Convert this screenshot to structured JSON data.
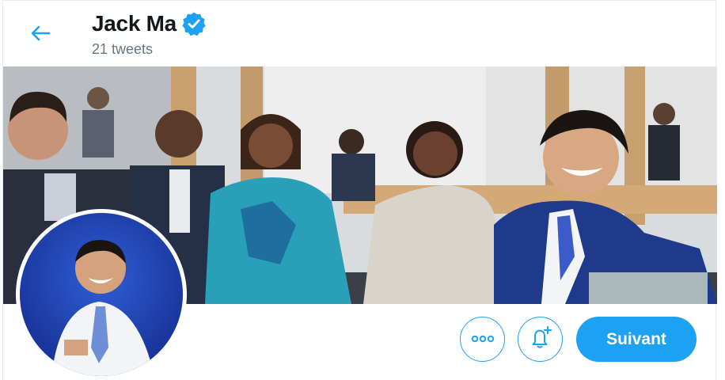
{
  "header": {
    "name": "Jack Ma",
    "tweet_count": "21 tweets"
  },
  "icons": {
    "back": "back-arrow-icon",
    "verified": "verified-badge-icon",
    "more": "more-dots-icon",
    "notification": "bell-plus-icon"
  },
  "actions": {
    "follow_label": "Suivant"
  },
  "colors": {
    "accent": "#1da1f2",
    "text": "#14171a",
    "muted": "#657786"
  }
}
